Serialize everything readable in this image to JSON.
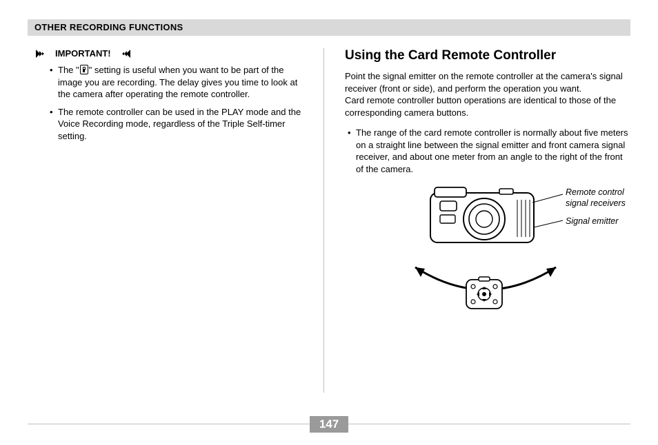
{
  "header": {
    "title": "OTHER RECORDING FUNCTIONS"
  },
  "left": {
    "important_label": "IMPORTANT!",
    "bullets": [
      {
        "pre": "The \"",
        "post": "\" setting is useful when you want to be part of the image you are recording. The delay gives you time to look at the camera after operating the remote controller."
      },
      {
        "text": "The remote controller can be used in the PLAY mode and the Voice Recording mode, regardless of the Triple Self-timer setting."
      }
    ]
  },
  "right": {
    "heading": "Using the Card Remote Controller",
    "para1": "Point the signal emitter on the remote controller at the camera's signal receiver (front or side), and perform the operation you want.",
    "para2": "Card remote controller button operations are identical to those of the corresponding camera buttons.",
    "bullet": "The range of the card remote controller is normally about five meters on a straight line between the signal emitter and front camera signal receiver, and about one meter from an angle to the right of the front of the camera.",
    "diagram": {
      "label_receivers": "Remote control signal receivers",
      "label_emitter": "Signal emitter"
    }
  },
  "page_number": "147"
}
